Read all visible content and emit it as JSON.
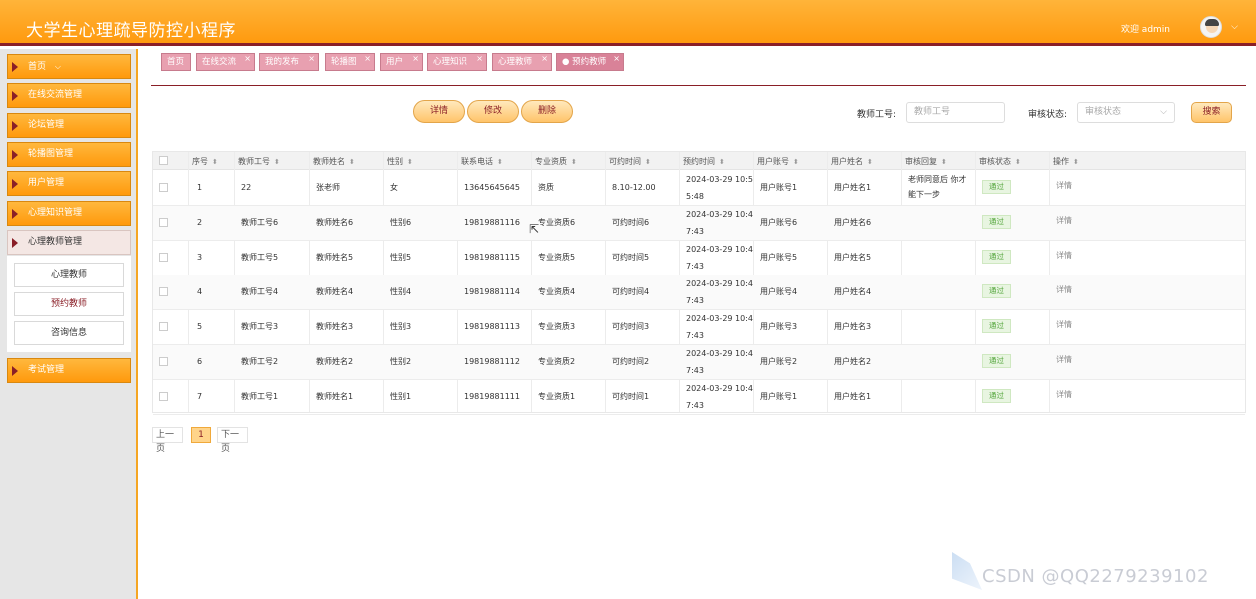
{
  "header": {
    "title": "大学生心理疏导防控小程序",
    "welcome": "欢迎 admin",
    "chevron": "⌵"
  },
  "sidebar": {
    "items": [
      {
        "label": "首页",
        "extra": "⌵"
      },
      {
        "label": "在线交流管理"
      },
      {
        "label": "论坛管理"
      },
      {
        "label": "轮播图管理"
      },
      {
        "label": "用户管理"
      },
      {
        "label": "心理知识管理"
      },
      {
        "label": "心理教师管理"
      },
      {
        "label": "考试管理"
      }
    ],
    "sub": [
      {
        "label": "心理教师"
      },
      {
        "label": "预约教师"
      },
      {
        "label": "咨询信息"
      }
    ]
  },
  "tabs": [
    {
      "label": "首页"
    },
    {
      "label": "在线交流"
    },
    {
      "label": "我的发布"
    },
    {
      "label": "轮播图"
    },
    {
      "label": "用户"
    },
    {
      "label": "心理知识"
    },
    {
      "label": "心理教师"
    },
    {
      "label": "● 预约教师"
    }
  ],
  "actions": {
    "detail": "详情",
    "edit": "修改",
    "delete": "删除"
  },
  "search": {
    "teacher_label": "教师工号:",
    "teacher_placeholder": "教师工号",
    "status_label": "审核状态:",
    "status_placeholder": "审核状态",
    "search_btn": "搜索"
  },
  "table": {
    "headers": [
      "序号",
      "教师工号",
      "教师姓名",
      "性别",
      "联系电话",
      "专业资质",
      "可约时间",
      "预约时间",
      "用户账号",
      "用户姓名",
      "审核回复",
      "审核状态",
      "操作"
    ],
    "rows": [
      {
        "no": "1",
        "tid": "22",
        "tname": "张老师",
        "gender": "女",
        "phone": "13645645645",
        "qual": "资质",
        "avail": "8.10-12.00",
        "time1": "2024-03-29 10:5",
        "time2": "5:48",
        "account": "用户账号1",
        "uname": "用户姓名1",
        "reply1": "老师同意后 你才",
        "reply2": "能下一步",
        "status": "通过",
        "op": "详情"
      },
      {
        "no": "2",
        "tid": "教师工号6",
        "tname": "教师姓名6",
        "gender": "性别6",
        "phone": "19819881116",
        "qual": "专业资质6",
        "avail": "可约时间6",
        "time1": "2024-03-29 10:4",
        "time2": "7:43",
        "account": "用户账号6",
        "uname": "用户姓名6",
        "reply1": "",
        "reply2": "",
        "status": "通过",
        "op": "详情"
      },
      {
        "no": "3",
        "tid": "教师工号5",
        "tname": "教师姓名5",
        "gender": "性别5",
        "phone": "19819881115",
        "qual": "专业资质5",
        "avail": "可约时间5",
        "time1": "2024-03-29 10:4",
        "time2": "7:43",
        "account": "用户账号5",
        "uname": "用户姓名5",
        "reply1": "",
        "reply2": "",
        "status": "通过",
        "op": "详情"
      },
      {
        "no": "4",
        "tid": "教师工号4",
        "tname": "教师姓名4",
        "gender": "性别4",
        "phone": "19819881114",
        "qual": "专业资质4",
        "avail": "可约时间4",
        "time1": "2024-03-29 10:4",
        "time2": "7:43",
        "account": "用户账号4",
        "uname": "用户姓名4",
        "reply1": "",
        "reply2": "",
        "status": "通过",
        "op": "详情"
      },
      {
        "no": "5",
        "tid": "教师工号3",
        "tname": "教师姓名3",
        "gender": "性别3",
        "phone": "19819881113",
        "qual": "专业资质3",
        "avail": "可约时间3",
        "time1": "2024-03-29 10:4",
        "time2": "7:43",
        "account": "用户账号3",
        "uname": "用户姓名3",
        "reply1": "",
        "reply2": "",
        "status": "通过",
        "op": "详情"
      },
      {
        "no": "6",
        "tid": "教师工号2",
        "tname": "教师姓名2",
        "gender": "性别2",
        "phone": "19819881112",
        "qual": "专业资质2",
        "avail": "可约时间2",
        "time1": "2024-03-29 10:4",
        "time2": "7:43",
        "account": "用户账号2",
        "uname": "用户姓名2",
        "reply1": "",
        "reply2": "",
        "status": "通过",
        "op": "详情"
      },
      {
        "no": "7",
        "tid": "教师工号1",
        "tname": "教师姓名1",
        "gender": "性别1",
        "phone": "19819881111",
        "qual": "专业资质1",
        "avail": "可约时间1",
        "time1": "2024-03-29 10:4",
        "time2": "7:43",
        "account": "用户账号1",
        "uname": "用户姓名1",
        "reply1": "",
        "reply2": "",
        "status": "通过",
        "op": "详情"
      }
    ]
  },
  "pager": {
    "prev": "上一页",
    "current": "1",
    "next": "下一页"
  },
  "watermark": "CSDN @QQ2279239102"
}
